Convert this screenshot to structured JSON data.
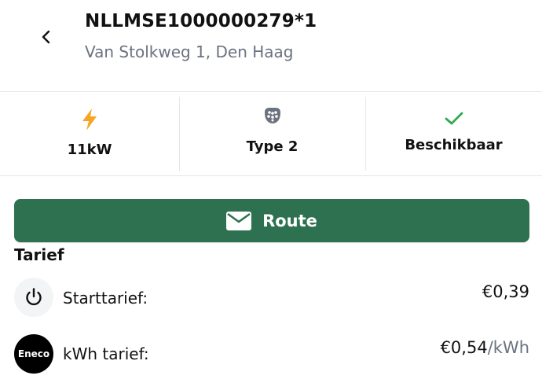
{
  "header": {
    "title": "NLLMSE1000000279*1",
    "subtitle": "Van Stolkweg 1, Den Haag"
  },
  "info": {
    "power": "11kW",
    "connector": "Type 2",
    "status": "Beschikbaar"
  },
  "route_button": {
    "label": "Route"
  },
  "tarief": {
    "title": "Tarief",
    "rows": [
      {
        "label": "Starttarief:",
        "price": "€0,39",
        "unit": ""
      },
      {
        "label": "kWh tarief:",
        "price": "€0,54",
        "unit": "/kWh",
        "logo": "Eneco"
      }
    ]
  },
  "colors": {
    "accent": "#2e7150",
    "bolt": "#f5a623",
    "check": "#34a853",
    "muted": "#6b7280"
  },
  "icons": [
    "back-arrow-icon",
    "bolt-icon",
    "type2-connector-icon",
    "check-icon",
    "mail-icon",
    "power-icon",
    "eneco-logo"
  ]
}
